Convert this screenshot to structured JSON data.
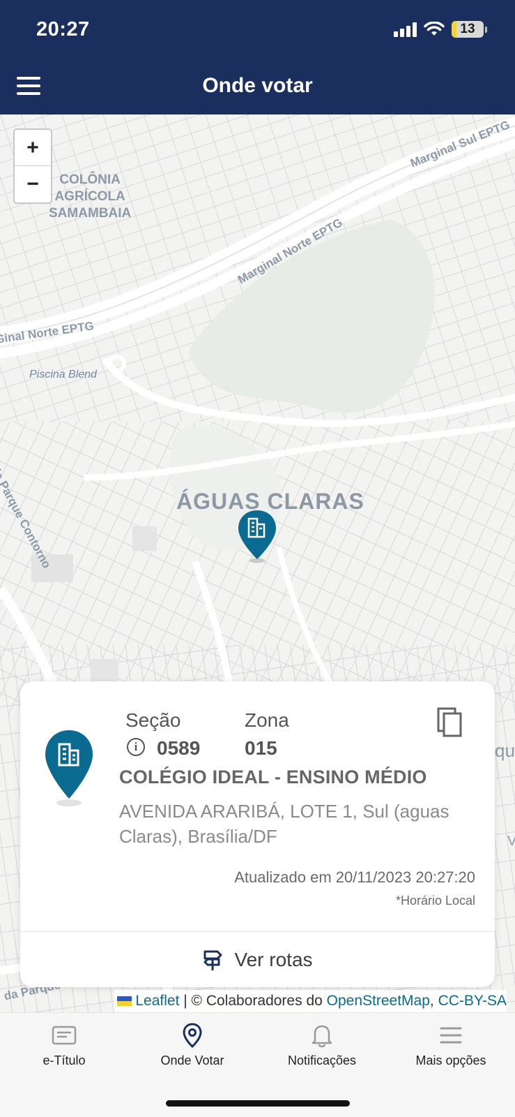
{
  "status_bar": {
    "time": "20:27",
    "battery": "13"
  },
  "header": {
    "title": "Onde votar",
    "menu_icon": "hamburger-menu-icon"
  },
  "map": {
    "zoom_in": "+",
    "zoom_out": "−",
    "labels": {
      "colonia_line1": "COLÔNIA",
      "colonia_line2": "AGRÍCOLA",
      "colonia_line3": "SAMAMBAIA",
      "marginal_sul": "Marginal Sul EPTG",
      "marginal_norte": "Marginal Norte EPTG",
      "ginal_norte": "Ginal Norte EPTG",
      "piscina": "Piscina Blend",
      "aguas_claras": "ÁGUAS CLARAS",
      "parque_contorno": "da Parque Contorno",
      "parque_nu": "da Parque Nu",
      "right_qu": "qu",
      "right_v": "V"
    },
    "pin_icon": "building-pin-icon"
  },
  "card": {
    "secao_label": "Seção",
    "secao_value": "0589",
    "zona_label": "Zona",
    "zona_value": "015",
    "school_name": "COLÉGIO IDEAL - ENSINO MÉDIO",
    "address": "AVENIDA ARARIBÁ, LOTE 1, Sul (aguas Claras), Brasília/DF",
    "updated": "Atualizado em 20/11/2023 20:27:20",
    "local_time_note": "*Horário Local",
    "routes_button": "Ver rotas",
    "accent_color": "#0a6a8f"
  },
  "attribution": {
    "leaflet": "Leaflet",
    "separator": " | © Colaboradores do ",
    "osm": "OpenStreetMap",
    "comma": ", ",
    "license": "CC-BY-SA"
  },
  "bottom_nav": [
    {
      "label": "e-Título",
      "icon": "id-card-icon"
    },
    {
      "label": "Onde Votar",
      "icon": "location-pin-icon"
    },
    {
      "label": "Notificações",
      "icon": "bell-icon"
    },
    {
      "label": "Mais opções",
      "icon": "menu-lines-icon"
    }
  ]
}
